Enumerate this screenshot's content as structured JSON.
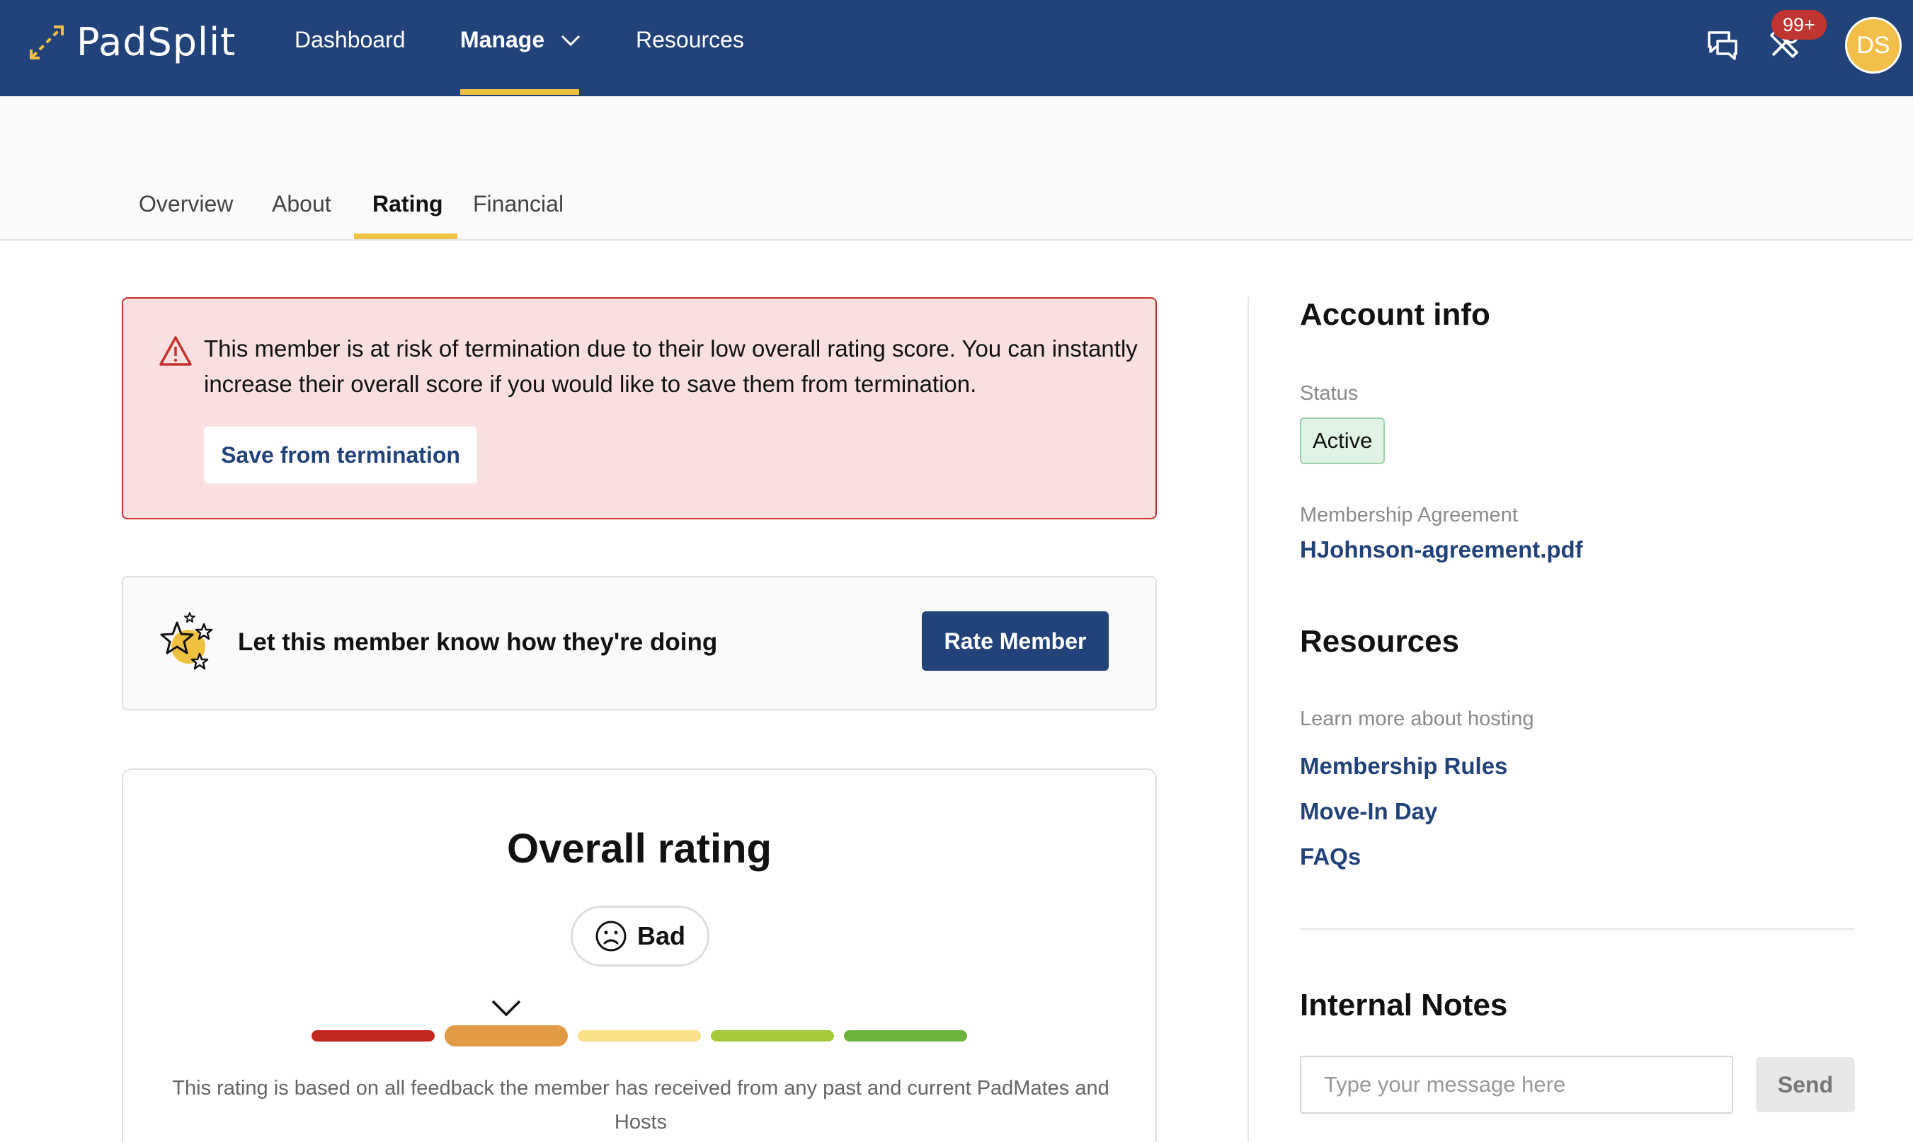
{
  "app": {
    "name": "PadSplit"
  },
  "nav": {
    "items": [
      {
        "label": "Dashboard"
      },
      {
        "label": "Manage",
        "active": true
      },
      {
        "label": "Resources"
      }
    ],
    "notification_count": "99+",
    "avatar_initials": "DS",
    "accent_color": "#f0c040",
    "background_color": "#22427a"
  },
  "tabs": [
    {
      "label": "Overview"
    },
    {
      "label": "About"
    },
    {
      "label": "Rating",
      "active": true
    },
    {
      "label": "Financial"
    }
  ],
  "alert": {
    "text": "This member is at risk of termination due to their low overall rating score. You can instantly increase their overall score if you would like to save them from termination.",
    "button_label": "Save from termination"
  },
  "rate_card": {
    "text": "Let this member know how they're doing",
    "button_label": "Rate Member"
  },
  "overall_rating": {
    "title": "Overall rating",
    "value_label": "Bad",
    "scale_colors": [
      "#c0281f",
      "#e39a45",
      "#fbe08a",
      "#a6c93a",
      "#6bb33c"
    ],
    "selected_index": 1,
    "description": "This rating is based on all feedback the member has received from any past and current PadMates and Hosts"
  },
  "account_info": {
    "heading": "Account info",
    "status_label": "Status",
    "status_value": "Active",
    "agreement_label": "Membership Agreement",
    "agreement_link": "HJohnson-agreement.pdf"
  },
  "resources": {
    "heading": "Resources",
    "subtitle": "Learn more about hosting",
    "links": [
      "Membership Rules",
      "Move-In Day",
      "FAQs"
    ]
  },
  "internal_notes": {
    "heading": "Internal Notes",
    "placeholder": "Type your message here",
    "send_label": "Send"
  }
}
